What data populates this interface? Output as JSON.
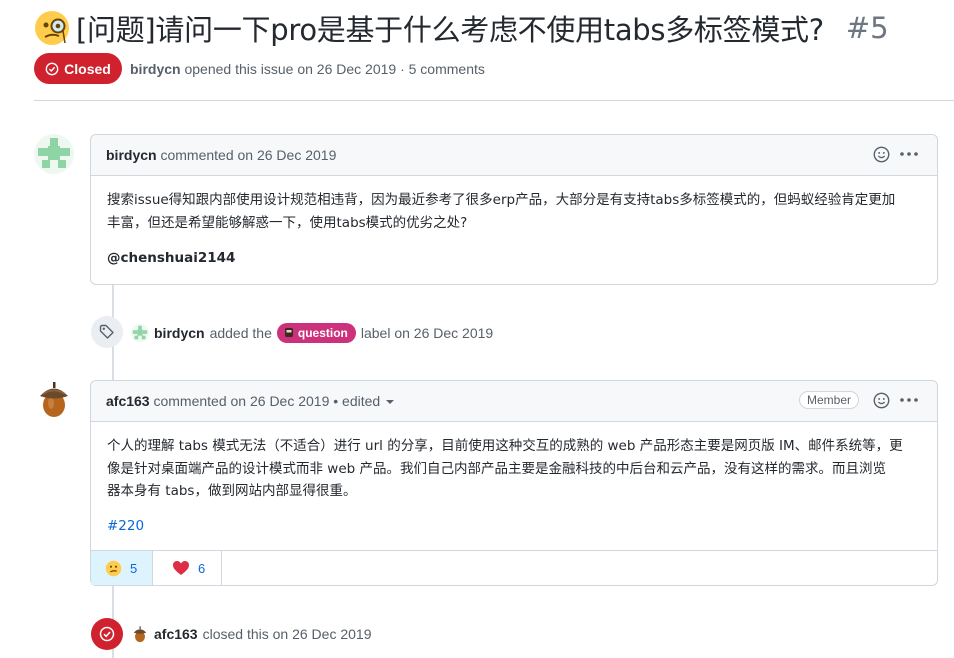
{
  "issue": {
    "title": "[问题]请问一下pro是基于什么考虑不使用tabs多标签模式?",
    "number": "#5",
    "state": "Closed",
    "author": "birdycn",
    "opened_text": "opened this issue on 26 Dec 2019 · 5 comments",
    "colors": {
      "closed": "#cf222e",
      "label": "#cc317c",
      "link": "#0969da"
    }
  },
  "comments": [
    {
      "author": "birdycn",
      "action": "commented on 26 Dec 2019",
      "body_lines": [
        "搜索issue得知跟内部使用设计规范相违背，因为最近参考了很多erp产品，大部分是有支持tabs多标签模式的，但蚂蚁经验肯定更加",
        "丰富，但还是希望能够解惑一下，使用tabs模式的优劣之处?"
      ],
      "mention": "@chenshuai2144",
      "icons": [
        "smiley-icon",
        "kebab-icon"
      ]
    },
    {
      "author": "afc163",
      "action": "commented on 26 Dec 2019 • edited",
      "badge": "Member",
      "body_lines": [
        "个人的理解 tabs 模式无法（不适合）进行 url 的分享，目前使用这种交互的成熟的 web 产品形态主要是网页版 IM、邮件系统等，更",
        "像是针对桌面端产品的设计模式而非 web 产品。我们自己内部产品主要是金融科技的中后台和云产品，没有这样的需求。而且浏览",
        "器本身有 tabs，做到网站内部显得很重。"
      ],
      "link": "#220",
      "reactions": [
        {
          "icon": "confused-face-icon",
          "count": "5"
        },
        {
          "icon": "heart-icon",
          "count": "6"
        }
      ]
    }
  ],
  "events": {
    "label_event": {
      "actor": "birdycn",
      "pre": "added the",
      "label": "question",
      "post": "label on 26 Dec 2019"
    },
    "closed_event": {
      "actor": "afc163",
      "text": "closed this on 26 Dec 2019"
    }
  }
}
